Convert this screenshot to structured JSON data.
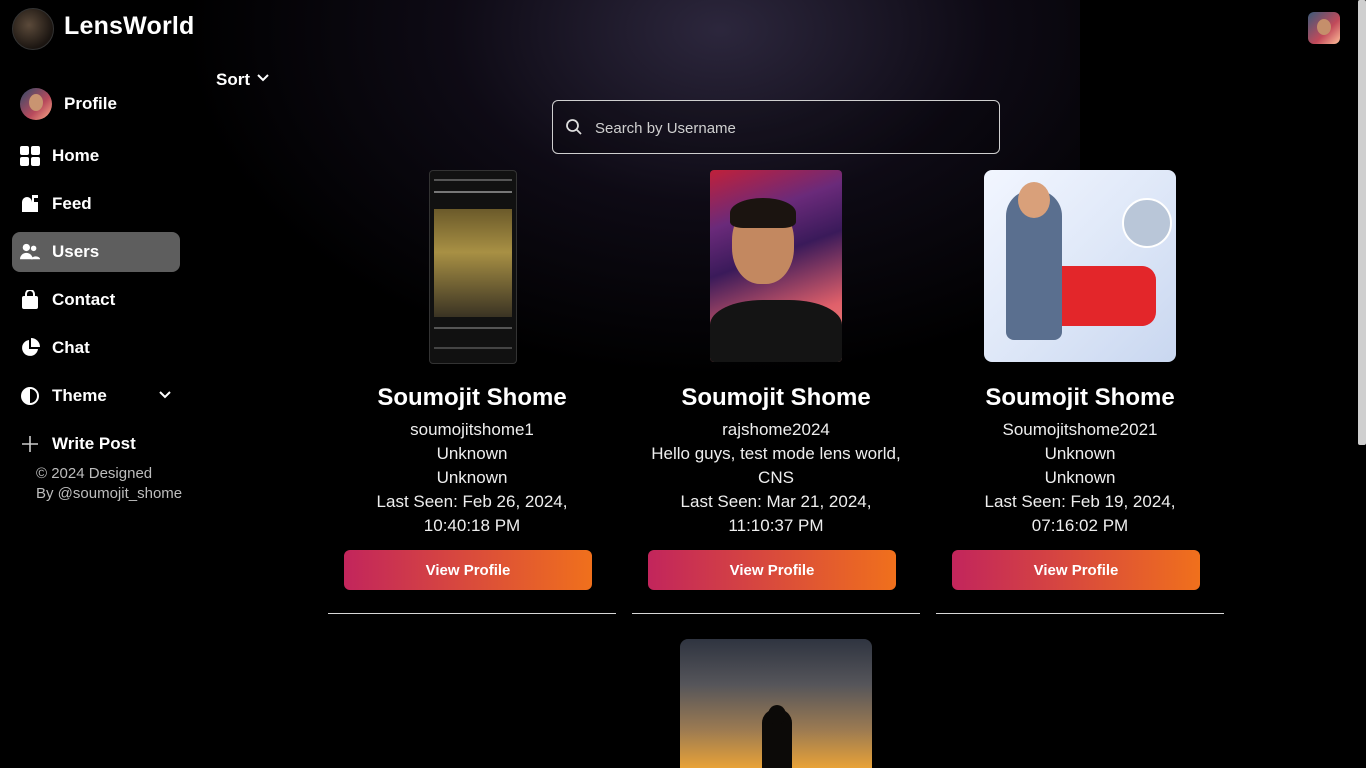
{
  "app": {
    "title": "LensWorld"
  },
  "sidebar": {
    "items": [
      {
        "label": "Profile",
        "icon": "avatar"
      },
      {
        "label": "Home",
        "icon": "grid-icon"
      },
      {
        "label": "Feed",
        "icon": "mailbox-icon"
      },
      {
        "label": "Users",
        "icon": "users-icon",
        "active": true
      },
      {
        "label": "Contact",
        "icon": "bag-icon"
      },
      {
        "label": "Chat",
        "icon": "pie-icon"
      },
      {
        "label": "Theme",
        "icon": "half-circle-icon"
      },
      {
        "label": "Write Post",
        "icon": "plus-icon"
      }
    ],
    "copyright_line1": "© 2024 Designed",
    "copyright_line2": "By @soumojit_shome"
  },
  "toolbar": {
    "sort_label": "Sort"
  },
  "search": {
    "placeholder": "Search by Username",
    "value": ""
  },
  "users": [
    {
      "name": "Soumojit Shome",
      "username": "soumojitshome1",
      "line1": "Unknown",
      "line2": "Unknown",
      "last_seen": "Last Seen: Feb 26, 2024, 10:40:18 PM",
      "button": "View Profile"
    },
    {
      "name": "Soumojit Shome",
      "username": "rajshome2024",
      "line1": "Hello guys, test mode lens world,",
      "line2": "CNS",
      "last_seen": "Last Seen: Mar 21, 2024, 11:10:37 PM",
      "button": "View Profile"
    },
    {
      "name": "Soumojit Shome",
      "username": "Soumojitshome2021",
      "line1": "Unknown",
      "line2": "Unknown",
      "last_seen": "Last Seen: Feb 19, 2024, 07:16:02 PM",
      "button": "View Profile"
    }
  ],
  "colors": {
    "accent_start": "#c2255c",
    "accent_end": "#f0701c",
    "active_item": "#5e5e5e"
  }
}
